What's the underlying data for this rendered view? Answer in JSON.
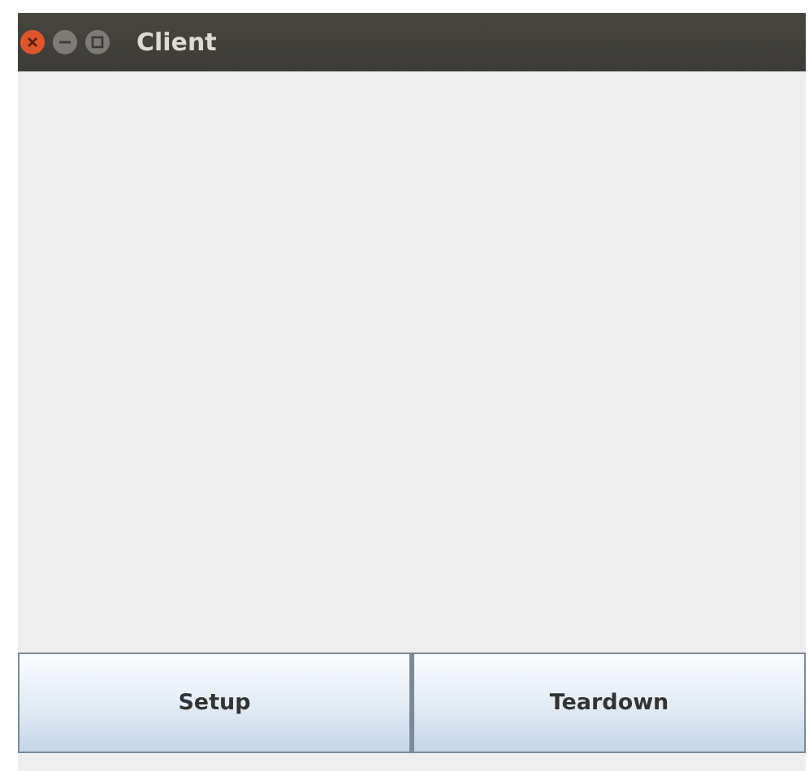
{
  "window": {
    "title": "Client"
  },
  "buttons": [
    {
      "label": "Setup"
    },
    {
      "label": "Teardown"
    }
  ]
}
